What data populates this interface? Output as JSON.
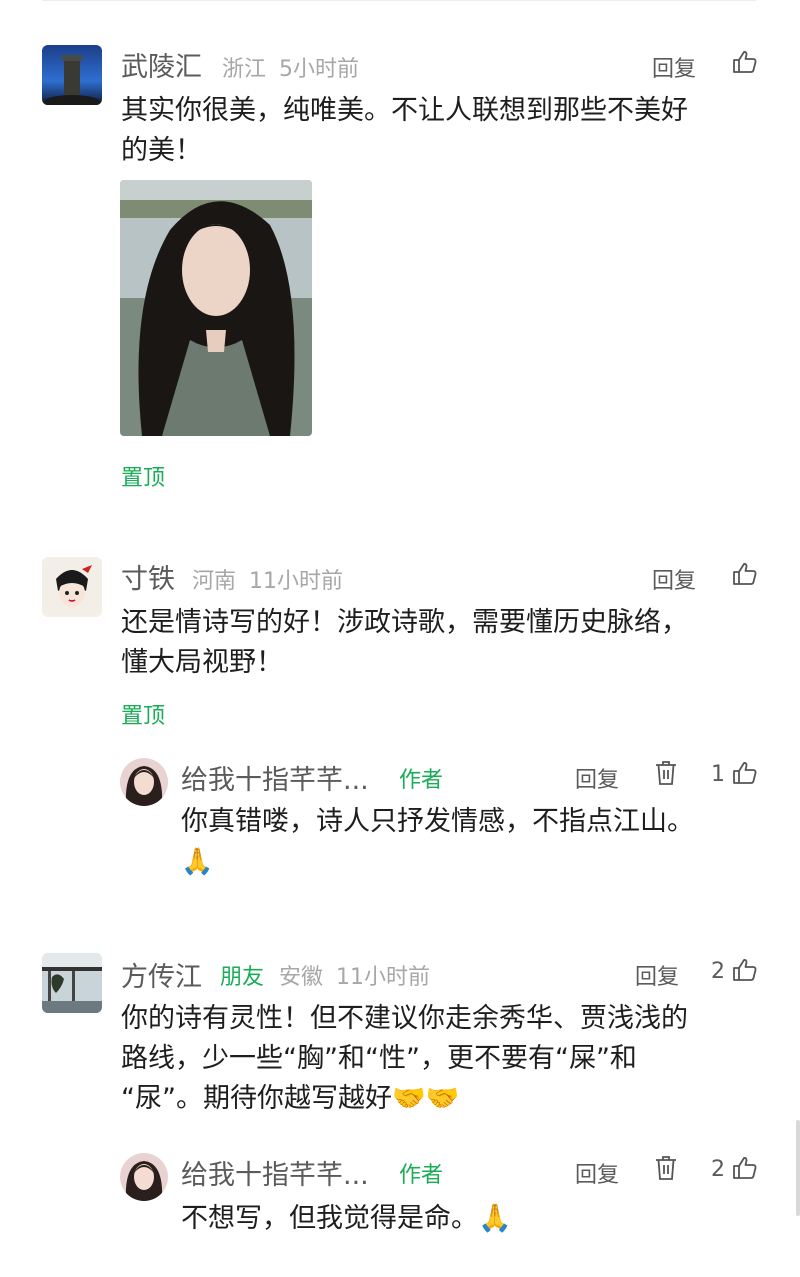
{
  "actions": {
    "reply_label": "回复"
  },
  "comments": [
    {
      "name": "武陵汇",
      "region": "浙江",
      "time": "5小时前",
      "text_line1": "其实你很美，纯唯美。不让人联想到那些不美好",
      "text_line2": "的美！",
      "pinned_label": "置顶",
      "likes": ""
    },
    {
      "name": "寸铁",
      "region": "河南",
      "time": "11小时前",
      "text_line1": "还是情诗写的好！涉政诗歌，需要懂历史脉络，",
      "text_line2": "懂大局视野！",
      "pinned_label": "置顶",
      "likes": "",
      "reply": {
        "name": "给我十指芊芊...",
        "badge": "作者",
        "text_line1": "你真错喽，诗人只抒发情感，不指点江山。",
        "emoji": "🙏",
        "likes": "1"
      }
    },
    {
      "name": "方传江",
      "badge": "朋友",
      "region": "安徽",
      "time": "11小时前",
      "text_line1": "你的诗有灵性！但不建议你走余秀华、贾浅浅的",
      "text_line2": "路线，少一些“胸”和“性”，更不要有“屎”和",
      "text_line3": "“尿”。期待你越写越好🤝🤝",
      "likes": "2",
      "reply": {
        "name": "给我十指芊芊...",
        "badge": "作者",
        "text_line1": "不想写，但我觉得是命。🙏",
        "likes": "2"
      }
    }
  ],
  "icons": {
    "like": "thumbs-up-icon",
    "delete": "trash-icon"
  },
  "colors": {
    "accent_green": "#1aad57",
    "meta_gray": "#a7a7a7"
  }
}
